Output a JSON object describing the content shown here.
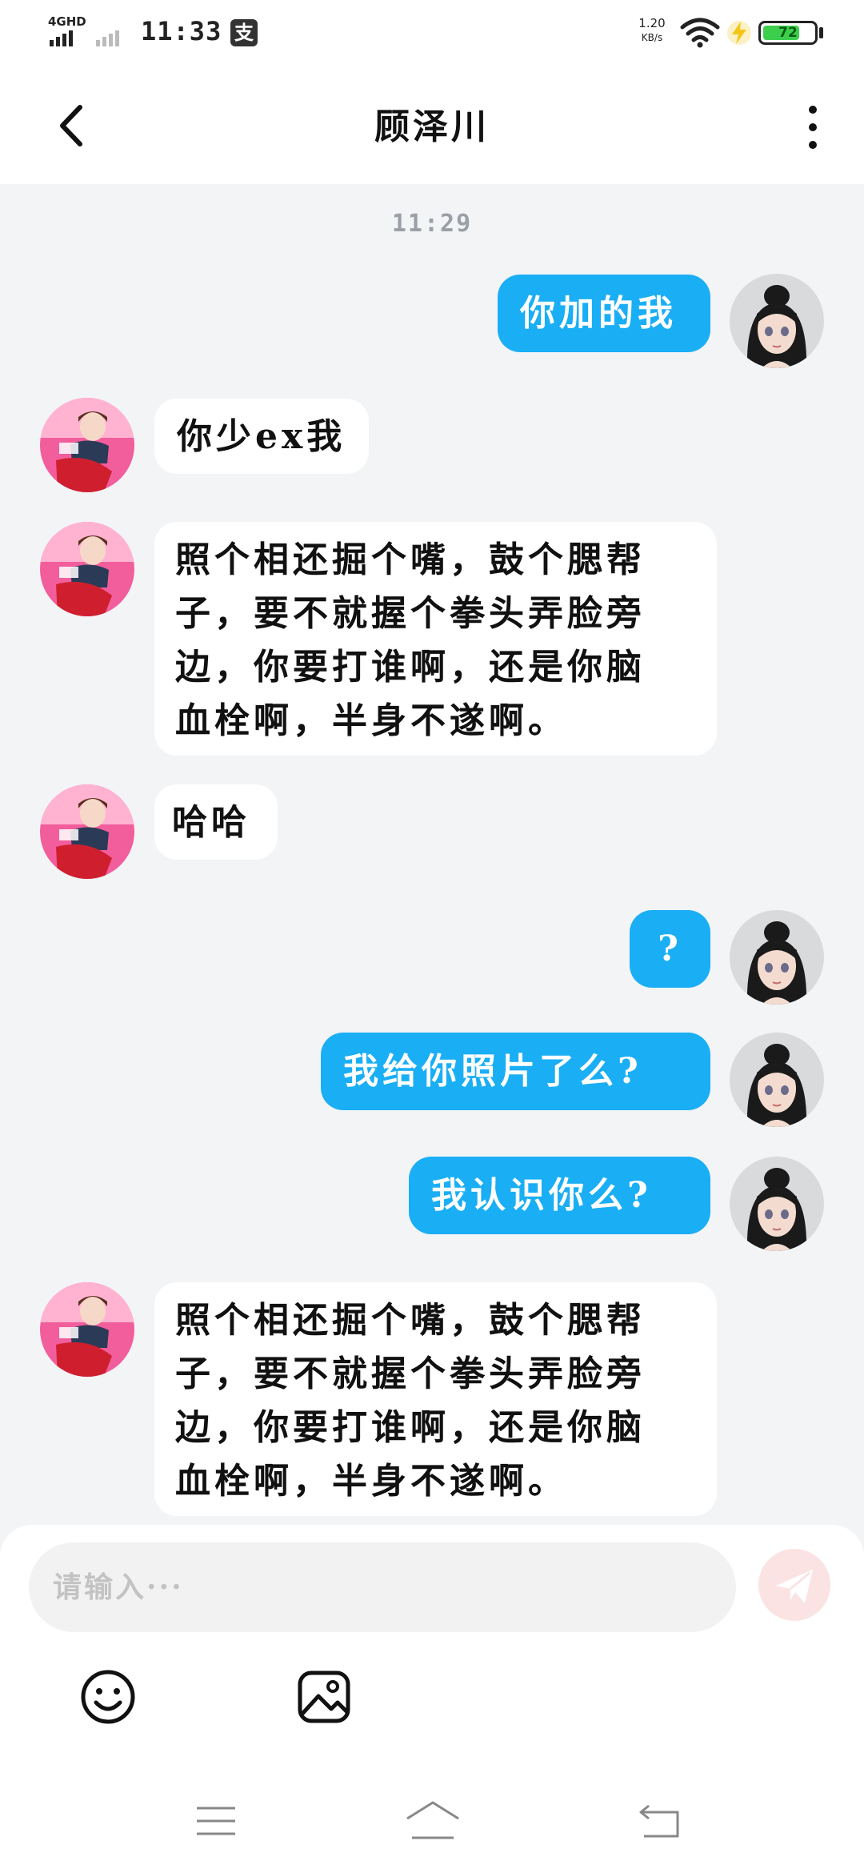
{
  "status_bar": {
    "network_label": "4GHD",
    "time": "11:33",
    "alipay_icon_label": "支",
    "speed_value": "1.20",
    "speed_unit": "KB/s",
    "battery_percent": "72",
    "battery_level": 0.72,
    "battery_color": "#3ccf4e"
  },
  "header": {
    "back_icon": "chevron-left-icon",
    "title": "顾泽川",
    "more_icon": "more-vertical-icon"
  },
  "chat": {
    "timestamp": "11:29",
    "colors": {
      "outgoing_bubble": "#1aaef5",
      "incoming_bubble": "#ffffff",
      "background": "#f3f4f6"
    },
    "messages": [
      {
        "sender": "me",
        "text": "你加的我"
      },
      {
        "sender": "them",
        "text": "你少ex我"
      },
      {
        "sender": "them",
        "lines": [
          "照个相还掘个嘴，鼓个腮帮",
          "子，要不就握个拳头弄脸旁",
          "边，你要打谁啊，还是你脑",
          "血栓啊，半身不遂啊。"
        ]
      },
      {
        "sender": "them",
        "text": "哈哈"
      },
      {
        "sender": "me",
        "text": "?"
      },
      {
        "sender": "me",
        "text": "我给你照片了么?"
      },
      {
        "sender": "me",
        "text": "我认识你么?"
      },
      {
        "sender": "them",
        "lines": [
          "照个相还掘个嘴，鼓个腮帮",
          "子，要不就握个拳头弄脸旁",
          "边，你要打谁啊，还是你脑",
          "血栓啊，半身不遂啊。"
        ]
      }
    ]
  },
  "input": {
    "placeholder": "请输入···",
    "send_icon": "send-icon",
    "emoji_icon": "emoji-icon",
    "image_icon": "image-icon"
  },
  "nav": {
    "menu_icon": "menu-icon",
    "home_icon": "home-icon",
    "back_icon": "back-icon"
  }
}
